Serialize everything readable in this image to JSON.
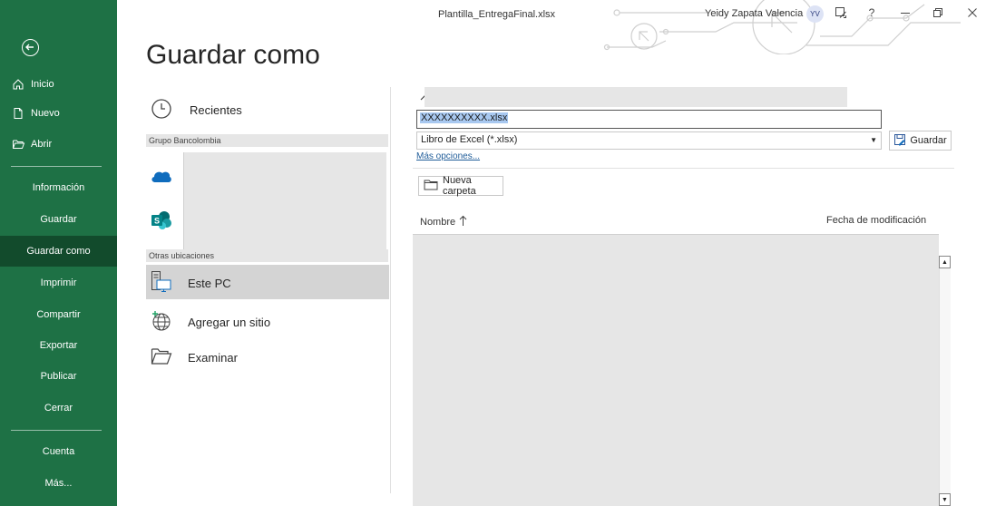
{
  "window": {
    "file_title": "Plantilla_EntregaFinal.xlsx",
    "user_name": "Yeidy Zapata Valencia",
    "user_initials": "YV",
    "help_label": "?"
  },
  "nav": {
    "top_items": [
      {
        "label": "Inicio",
        "icon": "home-icon"
      },
      {
        "label": "Nuevo",
        "icon": "new-doc-icon"
      },
      {
        "label": "Abrir",
        "icon": "folder-open-icon"
      }
    ],
    "items": [
      {
        "label": "Información"
      },
      {
        "label": "Guardar"
      },
      {
        "label": "Guardar como",
        "active": true
      },
      {
        "label": "Imprimir"
      },
      {
        "label": "Compartir"
      },
      {
        "label": "Exportar"
      },
      {
        "label": "Publicar"
      },
      {
        "label": "Cerrar"
      }
    ],
    "bottom_items": [
      {
        "label": "Cuenta"
      },
      {
        "label": "Más..."
      }
    ]
  },
  "page": {
    "title": "Guardar como"
  },
  "locations": {
    "recent_label": "Recientes",
    "group_label": "Grupo Bancolombia",
    "other_label": "Otras ubicaciones",
    "this_pc_label": "Este PC",
    "add_site_label": "Agregar un sitio",
    "browse_label": "Examinar"
  },
  "save_form": {
    "filename_value": "XXXXXXXXXX.xlsx",
    "filetype_value": "Libro de Excel (*.xlsx)",
    "save_label": "Guardar",
    "more_options_label": "Más opciones...",
    "new_folder_label": "Nueva carpeta",
    "col_name_label": "Nombre",
    "col_date_label": "Fecha de modificación"
  },
  "colors": {
    "nav_bg": "#1e7145",
    "nav_active": "#124b2c",
    "link": "#1f5c99"
  }
}
